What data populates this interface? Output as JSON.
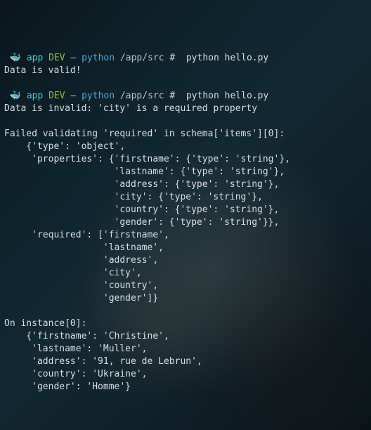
{
  "prompt": {
    "glyph": "🐳",
    "app": "app",
    "dev": "DEV",
    "dash": "—",
    "context": "python",
    "path": "/app/src",
    "hash": "#"
  },
  "run1": {
    "command": "python hello.py",
    "output": "Data is valid!"
  },
  "run2": {
    "command": "python hello.py",
    "lines": {
      "l01": "Data is invalid: 'city' is a required property",
      "l02": "",
      "l03": "Failed validating 'required' in schema['items'][0]:",
      "l04": "    {'type': 'object',",
      "l05": "     'properties': {'firstname': {'type': 'string'},",
      "l06": "                    'lastname': {'type': 'string'},",
      "l07": "                    'address': {'type': 'string'},",
      "l08": "                    'city': {'type': 'string'},",
      "l09": "                    'country': {'type': 'string'},",
      "l10": "                    'gender': {'type': 'string'}},",
      "l11": "     'required': ['firstname',",
      "l12": "                  'lastname',",
      "l13": "                  'address',",
      "l14": "                  'city',",
      "l15": "                  'country',",
      "l16": "                  'gender']}",
      "l17": "",
      "l18": "On instance[0]:",
      "l19": "    {'firstname': 'Christine',",
      "l20": "     'lastname': 'Muller',",
      "l21": "     'address': '91, rue de Lebrun',",
      "l22": "     'country': 'Ukraine',",
      "l23": "     'gender': 'Homme'}"
    }
  }
}
